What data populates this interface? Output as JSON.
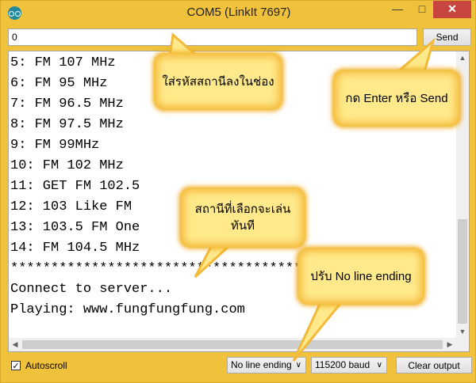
{
  "window": {
    "title": "COM5 (LinkIt 7697)"
  },
  "send_bar": {
    "input_value": "0",
    "send_label": "Send"
  },
  "output_lines": [
    "5: FM 107 MHz",
    "6: FM 95 MHz",
    "7: FM 96.5 MHz",
    "8: FM 97.5 MHz",
    "9: FM 99MHz",
    "10: FM 102 MHz",
    "11: GET FM 102.5",
    "12: 103 Like FM",
    "13: 103.5 FM One",
    "14: FM 104.5 MHz",
    "******************************************",
    "Connect to server...",
    "Playing: www.fungfungfung.com"
  ],
  "footer": {
    "autoscroll_label": "Autoscroll",
    "autoscroll_checked": true,
    "line_ending": "No line ending",
    "baud": "115200 baud",
    "clear_label": "Clear output"
  },
  "callouts": {
    "code_hint": "ใส่รหัสสถานีลงในช่อง",
    "send_hint": "กด Enter หรือ Send",
    "station_hint": "สถานีที่เลือกจะเล่นทันที",
    "lineending_hint": "ปรับ No line ending"
  },
  "colors": {
    "callout_fill": "#ffe98a",
    "callout_glow": "#f4b93a",
    "close_button": "#c7463f"
  }
}
